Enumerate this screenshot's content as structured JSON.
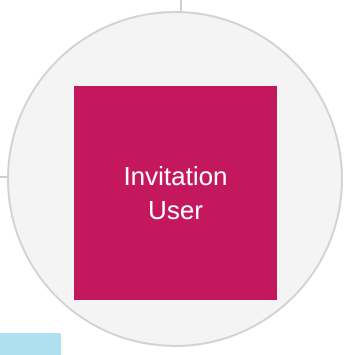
{
  "diagram": {
    "node": {
      "line1": "Invitation",
      "line2": "User",
      "fill_color": "#c4185e",
      "text_color": "#ffffff"
    },
    "container": {
      "fill_color": "#f4f4f4",
      "border_color": "#d2d2d2"
    },
    "edge_tab": {
      "fill_color": "#aee0f2"
    }
  }
}
